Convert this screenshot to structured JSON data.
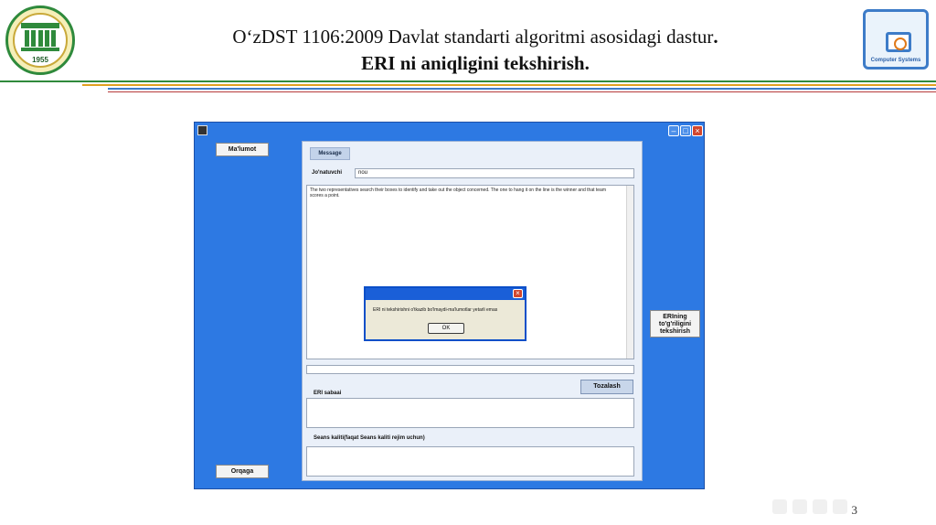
{
  "slide": {
    "title_line1": "O‘zDST 1106:2009 Davlat standarti algoritmi asosidagi dastur",
    "title_line1_end": ".",
    "title_line2": "ERI ni aniqligini tekshirish.",
    "page_number": "3",
    "logo_left_year": "1955",
    "logo_right_caption": "Computer Systems",
    "colors": {
      "rule_green": "#2f8a3c",
      "rule_gold": "#e0a020",
      "rule_blue": "#3d7cc8",
      "rule_red": "#b73a3a"
    }
  },
  "window": {
    "icons": {
      "app": "app-icon",
      "minimize": "minimize-icon",
      "maximize": "maximize-icon",
      "close": "close-icon"
    },
    "background": "#2d79e3",
    "buttons": {
      "malumot": "Ma'lumot",
      "orqaga": "Orqaga",
      "eri_check": "ERIning to'g'riligini tekshirish",
      "tozalash": "Tozalash"
    },
    "message_tab": "Message",
    "labels": {
      "jonatuvchi": "Jo'natuvchi",
      "eri_sabaai": "ERI sabaai",
      "seans_kaliti": "Seans kaliti(faqat Seans kaliti rejim uchun)"
    },
    "fields": {
      "jonatuvchi_value": "nou",
      "message_text": "The two representatives search their boxes to identify and take out the object concerned. The one to hang it on the line is the winner and that team scores a point."
    }
  },
  "dialog": {
    "message": "ERI ni tekshirishni o'tkazib bo'lmaydi-ma'lumotlar yetarli emas",
    "ok_label": "OK",
    "close_icon": "close-icon"
  }
}
